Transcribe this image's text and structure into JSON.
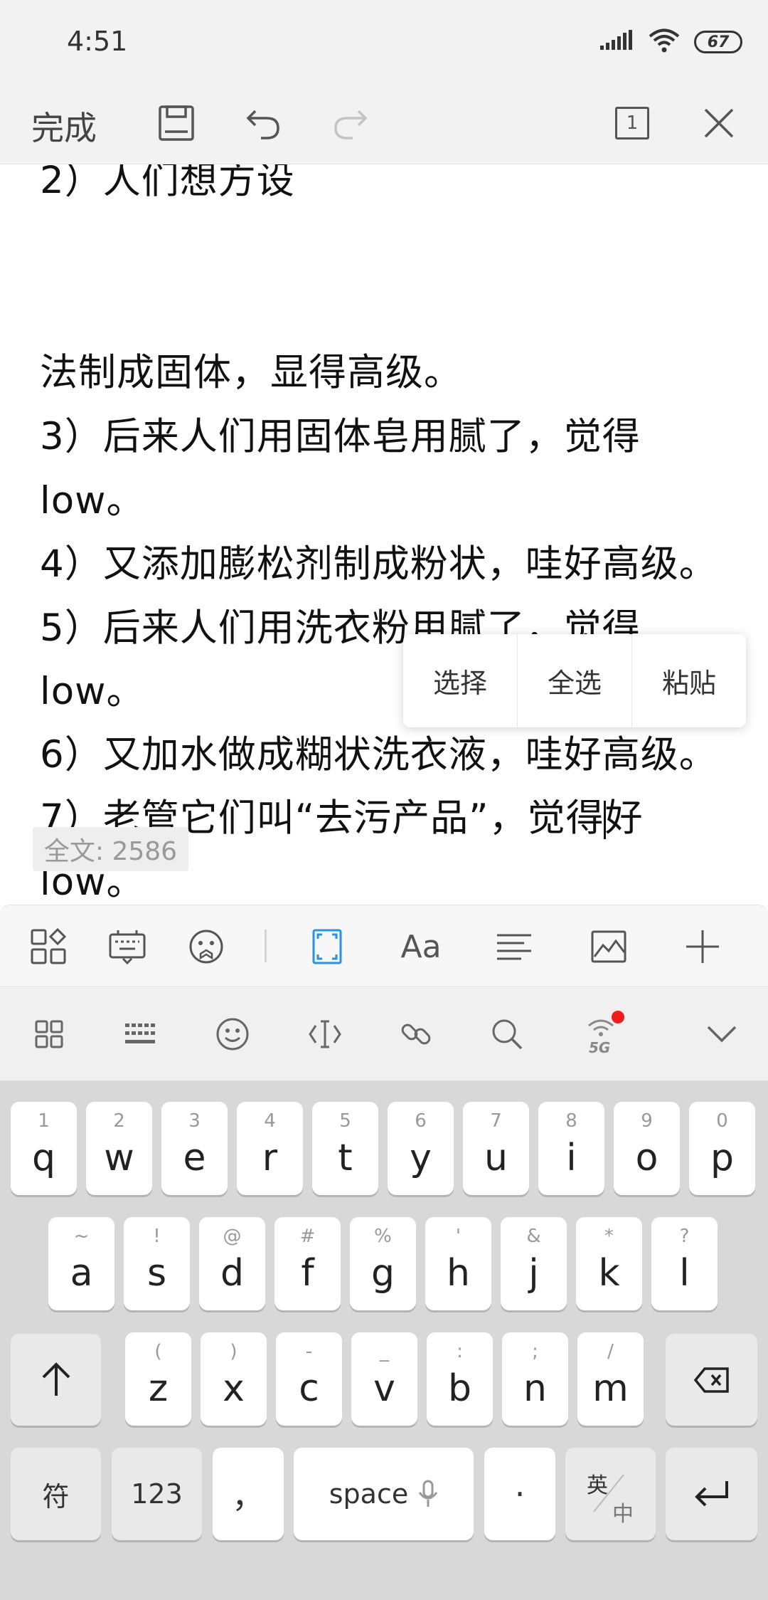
{
  "status": {
    "time": "4:51",
    "battery": "67"
  },
  "toolbar": {
    "done_label": "完成",
    "page_count": "1"
  },
  "document": {
    "lines": [
      "2）人们想方设",
      "法制成固体，显得高级。",
      "3）后来人们用固体皂用腻了，觉得",
      "low。",
      "4）又添加膨松剂制成粉状，哇好高级。",
      "5）后来人们用洗衣粉用腻了，觉得",
      "low。",
      "6）又加水做成糊状洗衣液，哇好高级。",
      "7）老管它们叫“去污产品”，觉得",
      "好",
      "low。"
    ]
  },
  "context_menu": {
    "items": [
      "选择",
      "全选",
      "粘贴"
    ]
  },
  "word_count": "全文: 2586",
  "keyboard": {
    "row1": [
      [
        "1",
        "q"
      ],
      [
        "2",
        "w"
      ],
      [
        "3",
        "e"
      ],
      [
        "4",
        "r"
      ],
      [
        "5",
        "t"
      ],
      [
        "6",
        "y"
      ],
      [
        "7",
        "u"
      ],
      [
        "8",
        "i"
      ],
      [
        "9",
        "o"
      ],
      [
        "0",
        "p"
      ]
    ],
    "row2": [
      [
        "~",
        "a"
      ],
      [
        "!",
        "s"
      ],
      [
        "@",
        "d"
      ],
      [
        "#",
        "f"
      ],
      [
        "%",
        "g"
      ],
      [
        "'",
        "h"
      ],
      [
        "&",
        "j"
      ],
      [
        "*",
        "k"
      ],
      [
        "?",
        "l"
      ]
    ],
    "row3": [
      [
        "(",
        "z"
      ],
      [
        ")",
        "x"
      ],
      [
        "-",
        "c"
      ],
      [
        "_",
        "v"
      ],
      [
        ":",
        "b"
      ],
      [
        ";",
        "n"
      ],
      [
        "/",
        "m"
      ]
    ],
    "symbol_label": "符",
    "num_label": "123",
    "comma_label": "，",
    "space_label": "space",
    "period_label": "·",
    "lang_top": "英",
    "lang_bottom": "中"
  },
  "icons": {
    "ime_5g_badge": "5G",
    "font_size_label": "Aa"
  },
  "colors": {
    "accent": "#2a92e6",
    "badge": "#f21c1c"
  }
}
